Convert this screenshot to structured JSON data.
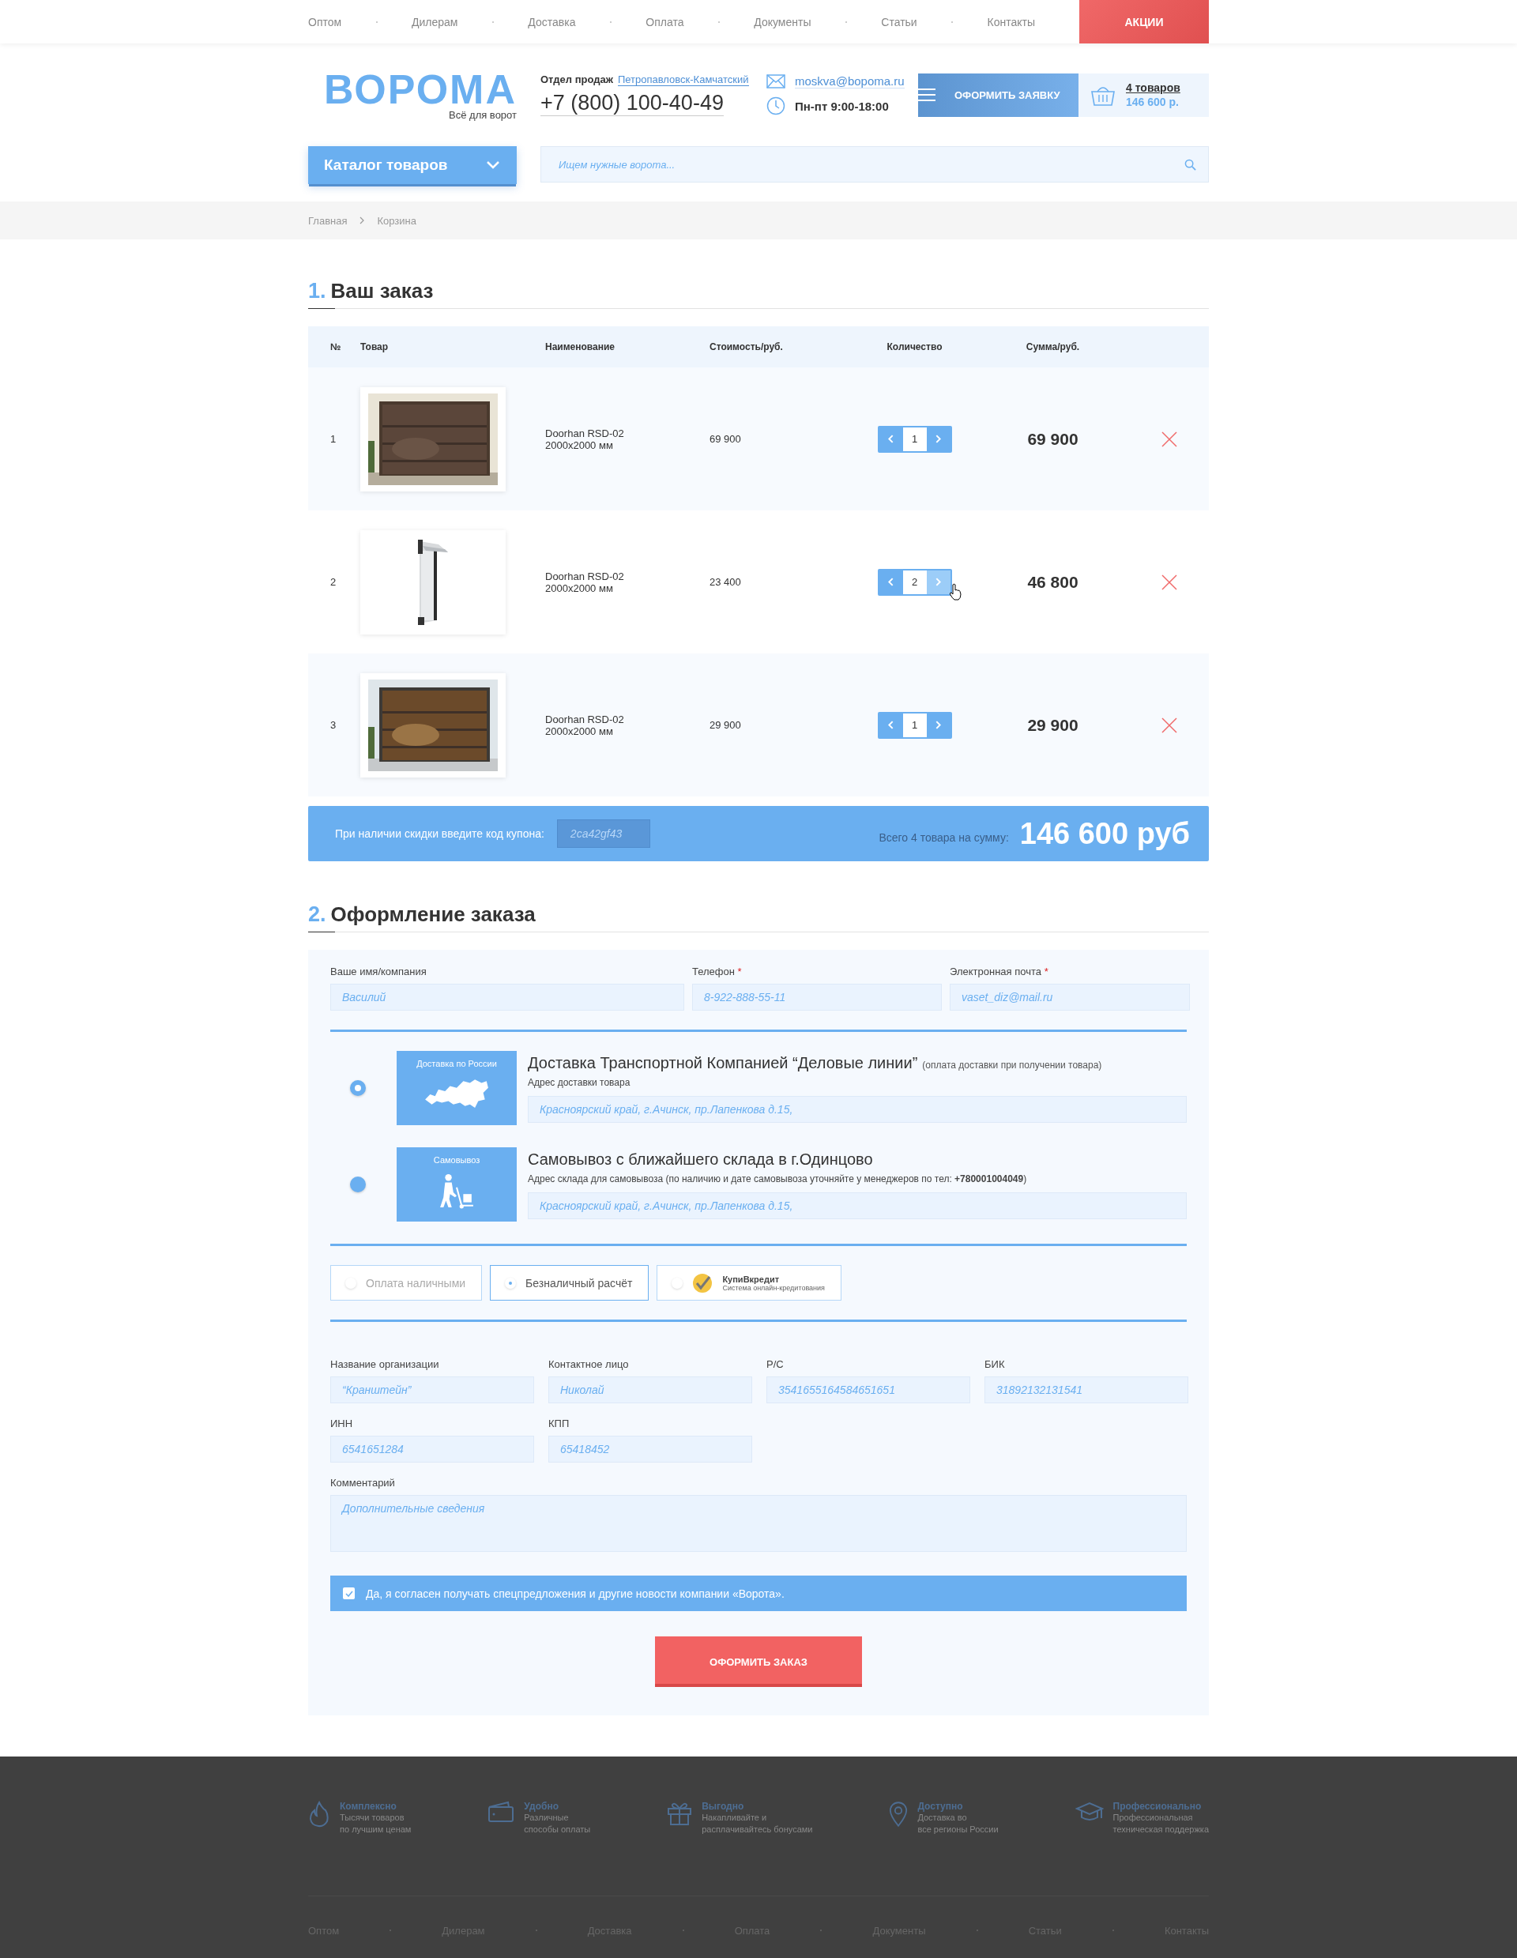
{
  "top_nav": {
    "links": [
      "Оптом",
      "Дилерам",
      "Доставка",
      "Оплата",
      "Документы",
      "Статьи",
      "Контакты"
    ],
    "promo_button": "АКЦИИ"
  },
  "header": {
    "logo": "ВОРОМА",
    "tagline": "Всё для ворот",
    "sales_label": "Отдел продаж",
    "city": "Петропавловск-Камчатский",
    "phone": "+7 (800) 100-40-49",
    "email": "moskva@bopoma.ru",
    "hours": "Пн-пт 9:00-18:00",
    "order_button": "ОФОРМИТЬ ЗАЯВКУ",
    "cart": {
      "count": "4 товаров",
      "total": "146 600 р."
    }
  },
  "catalog_button": "Каталог товаров",
  "search": {
    "placeholder": "Ищем нужные ворота..."
  },
  "breadcrumbs": [
    "Главная",
    "Корзина"
  ],
  "order_section": {
    "number": "1.",
    "title": "Ваш заказ",
    "table": {
      "columns": [
        "№",
        "Товар",
        "Наименование",
        "Стоимость/руб.",
        "Количество",
        "Сумма/руб."
      ],
      "rows": [
        {
          "no": "1",
          "name": "Doorhan RSD-02",
          "size": "2000x2000 мм",
          "price": "69 900",
          "quantity": "1",
          "sum": "69 900",
          "hovered": false
        },
        {
          "no": "2",
          "name": "Doorhan RSD-02",
          "size": "2000x2000 мм",
          "price": "23 400",
          "quantity": "2",
          "sum": "46 800",
          "hovered": true
        },
        {
          "no": "3",
          "name": "Doorhan RSD-02",
          "size": "2000x2000 мм",
          "price": "29 900",
          "quantity": "1",
          "sum": "29 900",
          "hovered": false
        }
      ]
    },
    "coupon": {
      "label": "При наличии скидки введите код купона:",
      "placeholder": "2ca42gf43"
    },
    "total": {
      "label": "Всего 4 товара на сумму:",
      "amount": "146 600 руб"
    }
  },
  "checkout_section": {
    "number": "2.",
    "title": "Оформление заказа",
    "contact_fields": [
      {
        "label": "Ваше имя/компания",
        "placeholder": "Василий"
      },
      {
        "label": "Телефон",
        "required_mark": "*",
        "placeholder": "8-922-888-55-11"
      },
      {
        "label": "Электронная почта",
        "required_mark": "*",
        "placeholder": "vaset_diz@mail.ru"
      }
    ],
    "delivery_options": [
      {
        "selected": true,
        "tile_label": "Доставка по России",
        "title": "Доставка Транспортной Компанией “Деловые линии”",
        "note": "(оплата доставки при получении товара)",
        "address_label": "Адрес доставки товара",
        "address_placeholder": "Красноярский край, г.Ачинск, пр.Лапенкова д.15,"
      },
      {
        "selected": false,
        "tile_label": "Самовывоз",
        "title": "Самовывоз с ближайшего склада в г.Одинцово",
        "address_label": "Адрес склада для самовывоза (по наличию и дате самовывоза уточняйте у менеджеров по тел: **+780001004049**)",
        "address_placeholder": "Красноярский край, г.Ачинск, пр.Лапенкова д.15,"
      }
    ],
    "payment_options": [
      {
        "kind": "text",
        "label": "Оплата наличными",
        "selected": false
      },
      {
        "kind": "text",
        "label": "Безналичный расчёт",
        "selected": true
      },
      {
        "kind": "logo",
        "label": "КупиВкредит",
        "subtitle": "Система онлайн-кредитования",
        "selected": false
      }
    ],
    "company_fields": [
      {
        "label": "Название организации",
        "placeholder": "“Кранштейн”"
      },
      {
        "label": "Контактное лицо",
        "placeholder": "Николай"
      },
      {
        "label": "Р/С",
        "placeholder": "3541655164584651651"
      },
      {
        "label": "БИК",
        "placeholder": "31892132131541"
      },
      {
        "label": "ИНН",
        "placeholder": "6541651284"
      },
      {
        "label": "КПП",
        "placeholder": "65418452"
      }
    ],
    "comment": {
      "label": "Комментарий",
      "placeholder": "Дополнительные сведения"
    },
    "consent": {
      "checked": true,
      "text": "Да, я согласен получать спецпредложения и другие новости компании «Ворота»."
    },
    "submit_button": "ОФОРМИТЬ ЗАКАЗ"
  },
  "footer": {
    "features": [
      {
        "title": "Комплексно",
        "line1": "Тысячи товаров",
        "line2": "по лучшим ценам"
      },
      {
        "title": "Удобно",
        "line1": "Различные",
        "line2": "способы оплаты"
      },
      {
        "title": "Выгодно",
        "line1": "Накапливайте и",
        "line2": "расплачивайтесь бонусами"
      },
      {
        "title": "Доступно",
        "line1": "Доставка во",
        "line2": "все регионы России"
      },
      {
        "title": "Профессионально",
        "line1": "Профессиональная",
        "line2": "техническая поддержка"
      }
    ],
    "links": [
      "Оптом",
      "Дилерам",
      "Доставка",
      "Оплата",
      "Документы",
      "Статьи",
      "Контакты"
    ]
  }
}
